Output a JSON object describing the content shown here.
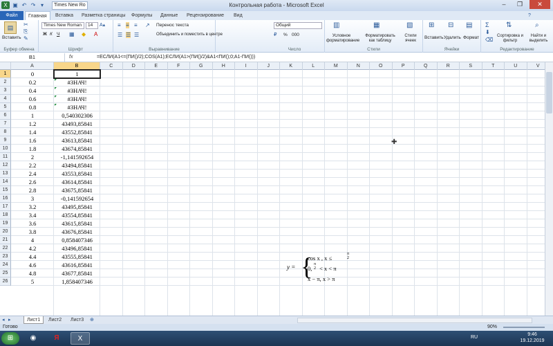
{
  "window": {
    "title": "Контрольная работа - Microsoft Excel",
    "font_preview": "Times New Ro"
  },
  "tabs": [
    "Файл",
    "Главная",
    "Вставка",
    "Разметка страницы",
    "Формулы",
    "Данные",
    "Рецензирование",
    "Вид"
  ],
  "ribbon": {
    "clipboard": {
      "label": "Буфер обмена",
      "paste": "Вставить"
    },
    "font": {
      "label": "Шрифт",
      "family": "Times New Roman",
      "size": "14",
      "bold": "Ж",
      "italic": "К",
      "underline": "Ч"
    },
    "alignment": {
      "label": "Выравнивание",
      "wrap": "Перенос текста",
      "merge": "Объединить и поместить в центре"
    },
    "number": {
      "label": "Число",
      "format": "Общий",
      "percent": "%",
      "thousands": "000"
    },
    "styles": {
      "label": "Стили",
      "conditional": "Условное форматирование",
      "as_table": "Форматировать как таблицу",
      "cell_styles": "Стили ячеек"
    },
    "cells": {
      "label": "Ячейки",
      "insert": "Вставить",
      "delete": "Удалить",
      "format": "Формат"
    },
    "editing": {
      "label": "Редактирование",
      "sort": "Сортировка и фильтр",
      "find": "Найти и выделить"
    }
  },
  "formula_bar": {
    "name_box": "B1",
    "fx": "fx",
    "formula": "=ЕСЛИ(A1<=(ПИ()/2);COS(A1);ЕСЛИ(A1>(ПИ()/2)&A1<ПИ();0;A1-ПИ()))"
  },
  "columns": [
    "A",
    "B",
    "C",
    "D",
    "E",
    "F",
    "G",
    "H",
    "I",
    "J",
    "K",
    "L",
    "M",
    "N",
    "O",
    "P",
    "Q",
    "R",
    "S",
    "T",
    "U",
    "V"
  ],
  "rows": [
    {
      "n": "1",
      "a": "0",
      "b": "1"
    },
    {
      "n": "2",
      "a": "0.2",
      "b": "#ЗНАЧ!",
      "err": true
    },
    {
      "n": "3",
      "a": "0.4",
      "b": "#ЗНАЧ!",
      "err": true
    },
    {
      "n": "4",
      "a": "0.6",
      "b": "#ЗНАЧ!",
      "err": true
    },
    {
      "n": "5",
      "a": "0.8",
      "b": "#ЗНАЧ!",
      "err": true
    },
    {
      "n": "6",
      "a": "1",
      "b": "0,540302306"
    },
    {
      "n": "7",
      "a": "1.2",
      "b": "43493,85841"
    },
    {
      "n": "8",
      "a": "1.4",
      "b": "43552,85841"
    },
    {
      "n": "9",
      "a": "1.6",
      "b": "43613,85841"
    },
    {
      "n": "10",
      "a": "1.8",
      "b": "43674,85841"
    },
    {
      "n": "11",
      "a": "2",
      "b": "-1,141592654"
    },
    {
      "n": "12",
      "a": "2.2",
      "b": "43494,85841"
    },
    {
      "n": "13",
      "a": "2.4",
      "b": "43553,85841"
    },
    {
      "n": "14",
      "a": "2.6",
      "b": "43614,85841"
    },
    {
      "n": "15",
      "a": "2.8",
      "b": "43675,85841"
    },
    {
      "n": "16",
      "a": "3",
      "b": "-0,141592654"
    },
    {
      "n": "17",
      "a": "3.2",
      "b": "43495,85841"
    },
    {
      "n": "18",
      "a": "3.4",
      "b": "43554,85841"
    },
    {
      "n": "19",
      "a": "3.6",
      "b": "43615,85841"
    },
    {
      "n": "20",
      "a": "3.8",
      "b": "43676,85841"
    },
    {
      "n": "21",
      "a": "4",
      "b": "0,858407346"
    },
    {
      "n": "22",
      "a": "4.2",
      "b": "43496,85841"
    },
    {
      "n": "23",
      "a": "4.4",
      "b": "43555,85841"
    },
    {
      "n": "24",
      "a": "4.6",
      "b": "43616,85841"
    },
    {
      "n": "25",
      "a": "4.8",
      "b": "43677,85841"
    },
    {
      "n": "26",
      "a": "5",
      "b": "1,858407346"
    }
  ],
  "equation": {
    "lhs": "y =",
    "case1": "cos x ,  x ≤",
    "pi": "π",
    "two": "2",
    "case2a": "0,",
    "case2b": "< x < π",
    "case3": "x − π,  x > π"
  },
  "sheets": [
    "Лист1",
    "Лист2",
    "Лист3"
  ],
  "status": {
    "ready": "Готово",
    "zoom": "90%"
  },
  "taskbar": {
    "lang": "RU",
    "time": "9:46",
    "date": "19.12.2019"
  },
  "colors": {
    "accent": "#2a66b8",
    "selection": "#f8d68a",
    "error_marker": "#1a8a3a"
  }
}
